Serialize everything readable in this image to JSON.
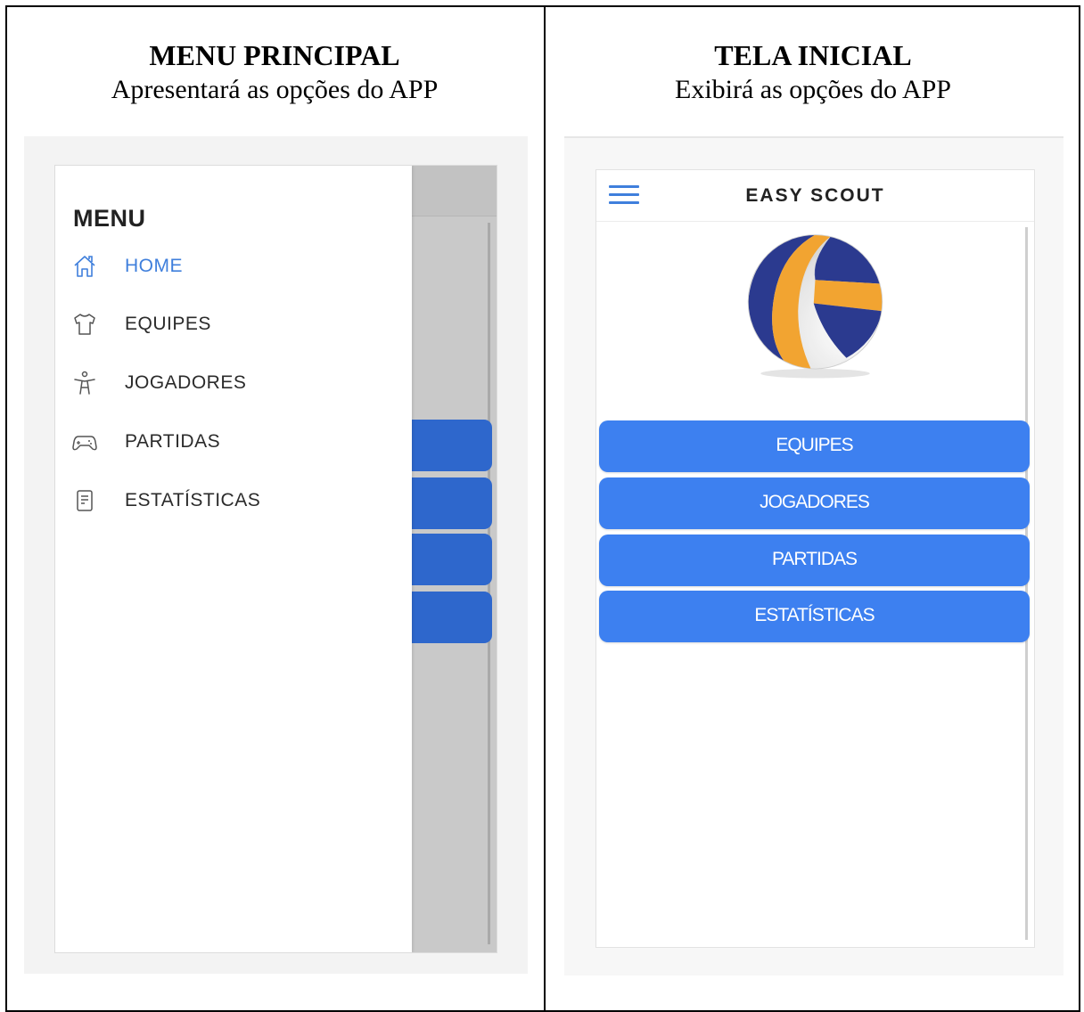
{
  "left": {
    "title": "MENU PRINCIPAL",
    "subtitle": "Apresentará as opções do APP",
    "drawer": {
      "title": "MENU",
      "items": [
        {
          "label": "HOME",
          "icon": "home-icon",
          "active": true
        },
        {
          "label": "EQUIPES",
          "icon": "shirt-icon"
        },
        {
          "label": "JOGADORES",
          "icon": "person-icon"
        },
        {
          "label": "PARTIDAS",
          "icon": "gamepad-icon"
        },
        {
          "label": "ESTATÍSTICAS",
          "icon": "document-icon"
        }
      ]
    }
  },
  "right": {
    "title": "TELA INICIAL",
    "subtitle": "Exibirá as opções do APP",
    "app": {
      "title": "EASY SCOUT",
      "menu_icon": "hamburger-menu-icon",
      "logo": "volleyball-icon",
      "buttons": [
        "EQUIPES",
        "JOGADORES",
        "PARTIDAS",
        "ESTATÍSTICAS"
      ]
    }
  },
  "colors": {
    "accent": "#3f7fdc",
    "button": "#3d80f0",
    "button_dimmed": "#2e67cc",
    "ball_blue": "#2b3a8f",
    "ball_orange": "#f2a431"
  }
}
